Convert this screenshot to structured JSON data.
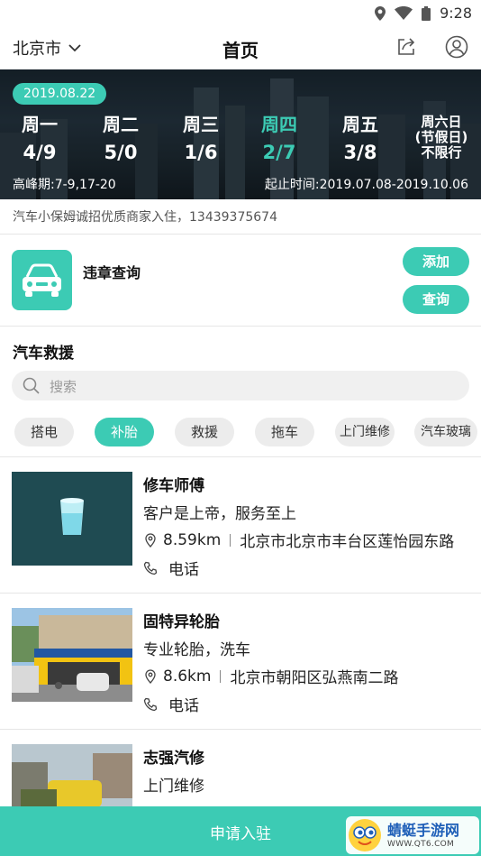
{
  "status_bar": {
    "time": "9:28"
  },
  "header": {
    "city": "北京市",
    "title": "首页"
  },
  "banner": {
    "date": "2019.08.22",
    "days": [
      {
        "name": "周一",
        "numbers": "4/9"
      },
      {
        "name": "周二",
        "numbers": "5/0"
      },
      {
        "name": "周三",
        "numbers": "1/6"
      },
      {
        "name": "周四",
        "numbers": "2/7"
      },
      {
        "name": "周五",
        "numbers": "3/8"
      }
    ],
    "weekend": {
      "line1": "周六日",
      "line2": "(节假日)",
      "line3": "不限行"
    },
    "peak": "高峰期:7-9,17-20",
    "period": "起止时间:2019.07.08-2019.10.06"
  },
  "notice": "汽车小保姆诚招优质商家入住，13439375674",
  "violation": {
    "title": "违章查询",
    "add_label": "添加",
    "query_label": "查询"
  },
  "rescue": {
    "title": "汽车救援",
    "search_placeholder": "搜索",
    "categories": [
      "搭电",
      "补胎",
      "救援",
      "拖车",
      "上门维修",
      "汽车玻璃"
    ],
    "active_category": "补胎"
  },
  "shops": [
    {
      "name": "修车师傅",
      "desc": "客户是上帝，服务至上",
      "distance": "8.59km",
      "address": "北京市北京市丰台区莲怡园东路",
      "phone_label": "电话"
    },
    {
      "name": "固特异轮胎",
      "desc": "专业轮胎，洗车",
      "distance": "8.6km",
      "address": "北京市朝阳区弘燕南二路",
      "phone_label": "电话"
    },
    {
      "name": "志强汽修",
      "desc": "上门维修"
    }
  ],
  "footer": {
    "apply_label": "申请入驻"
  },
  "watermark": {
    "title": "蜻蜓手游网",
    "url": "WWW.QT6.COM"
  },
  "colors": {
    "accent": "#3ccbb4"
  }
}
